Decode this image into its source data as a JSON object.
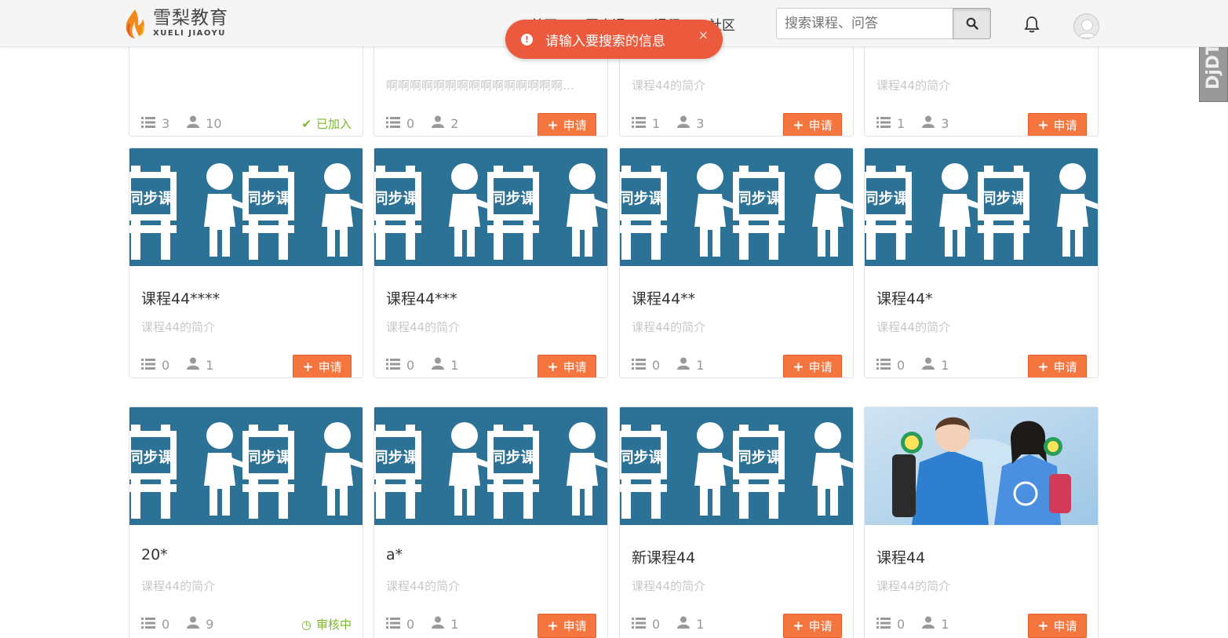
{
  "header": {
    "logo_cn": "雪梨教育",
    "logo_en": "XUELI JIAOYU",
    "nav": [
      "首页",
      "同步课",
      "课程",
      "社区"
    ],
    "search_placeholder": "搜索课程、问答"
  },
  "toast": {
    "message": "请输入要搜索的信息",
    "close": "×"
  },
  "ddt_label": "DjDT",
  "colors": {
    "accent": "#f5753f",
    "toast": "#eb5a3c",
    "cover": "#2c7196",
    "success": "#7ab829"
  },
  "cover_text": "同步课",
  "rows": [
    [
      {
        "title": "",
        "desc": "",
        "lessons": "3",
        "students": "10",
        "action": "已加入",
        "action_type": "joined"
      },
      {
        "title": "",
        "desc": "啊啊啊啊啊啊啊啊啊啊啊啊啊啊啊…",
        "lessons": "0",
        "students": "2",
        "action": "申请",
        "action_type": "apply"
      },
      {
        "title": "",
        "desc": "课程44的简介",
        "lessons": "1",
        "students": "3",
        "action": "申请",
        "action_type": "apply"
      },
      {
        "title": "",
        "desc": "课程44的简介",
        "lessons": "1",
        "students": "3",
        "action": "申请",
        "action_type": "apply"
      }
    ],
    [
      {
        "title": "课程44****",
        "desc": "课程44的简介",
        "lessons": "0",
        "students": "1",
        "action": "申请",
        "action_type": "apply"
      },
      {
        "title": "课程44***",
        "desc": "课程44的简介",
        "lessons": "0",
        "students": "1",
        "action": "申请",
        "action_type": "apply"
      },
      {
        "title": "课程44**",
        "desc": "课程44的简介",
        "lessons": "0",
        "students": "1",
        "action": "申请",
        "action_type": "apply"
      },
      {
        "title": "课程44*",
        "desc": "课程44的简介",
        "lessons": "0",
        "students": "1",
        "action": "申请",
        "action_type": "apply"
      }
    ],
    [
      {
        "title": "20*",
        "desc": "课程44的简介",
        "lessons": "0",
        "students": "9",
        "action": "审核中",
        "action_type": "pending"
      },
      {
        "title": "a*",
        "desc": "课程44的简介",
        "lessons": "0",
        "students": "1",
        "action": "申请",
        "action_type": "apply"
      },
      {
        "title": "新课程44",
        "desc": "课程44的简介",
        "lessons": "0",
        "students": "1",
        "action": "申请",
        "action_type": "apply"
      },
      {
        "title": "课程44",
        "desc": "课程44的简介",
        "lessons": "0",
        "students": "1",
        "action": "申请",
        "action_type": "apply",
        "cover": "photo"
      }
    ]
  ]
}
